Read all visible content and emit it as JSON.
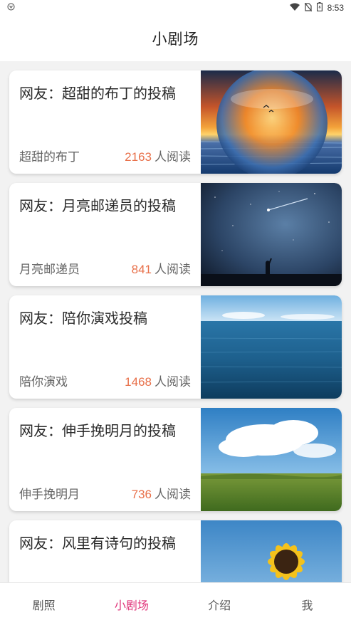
{
  "status_bar": {
    "time": "8:53",
    "icons": [
      "app-notification-icon",
      "wifi-icon",
      "no-sim-icon",
      "battery-icon"
    ]
  },
  "header": {
    "title": "小剧场"
  },
  "posts": [
    {
      "title": "网友：超甜的布丁的投稿",
      "author": "超甜的布丁",
      "count": "2163",
      "read_suffix": "人阅读",
      "image": "sunset-sea-sphere"
    },
    {
      "title": "网友：月亮邮递员的投稿",
      "author": "月亮邮递员",
      "count": "841",
      "read_suffix": "人阅读",
      "image": "night-sky-meteor"
    },
    {
      "title": "网友：陪你演戏投稿",
      "author": "陪你演戏",
      "count": "1468",
      "read_suffix": "人阅读",
      "image": "ocean-horizon"
    },
    {
      "title": "网友：伸手挽明月的投稿",
      "author": "伸手挽明月",
      "count": "736",
      "read_suffix": "人阅读",
      "image": "grassland-clouds"
    },
    {
      "title": "网友：风里有诗句的投稿",
      "author": "",
      "count": "",
      "read_suffix": "",
      "image": "sunflower-sky"
    }
  ],
  "bottom_nav": [
    {
      "label": "剧照",
      "active": false
    },
    {
      "label": "小剧场",
      "active": true
    },
    {
      "label": "介绍",
      "active": false
    },
    {
      "label": "我",
      "active": false
    }
  ],
  "colors": {
    "accent": "#e0347a",
    "count": "#e8704a",
    "background": "#f2f2f2"
  }
}
